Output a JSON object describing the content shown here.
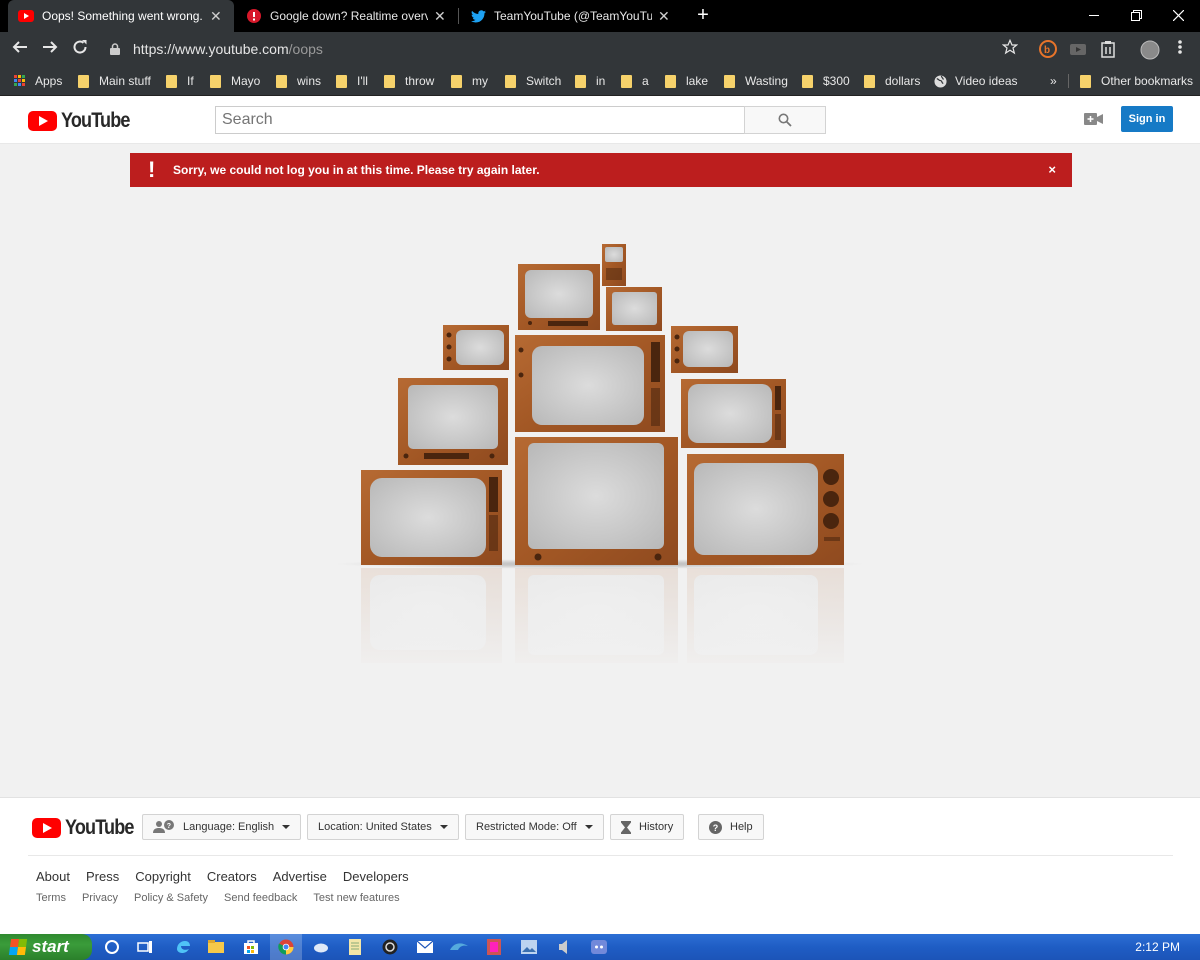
{
  "browser": {
    "tabs": [
      {
        "title": "Oops! Something went wrong. -",
        "icon": "youtube-icon",
        "active": true
      },
      {
        "title": "Google down? Realtime overview",
        "icon": "alert-icon",
        "active": false
      },
      {
        "title": "TeamYouTube (@TeamYouTube) |",
        "icon": "twitter-icon",
        "active": false
      }
    ],
    "new_tab": "+",
    "url_host": "https://www.youtube.com",
    "url_path": "/oops",
    "bookmarks": [
      "Apps",
      "Main stuff",
      "If",
      "Mayo",
      "wins",
      "I'll",
      "throw",
      "my",
      "Switch",
      "in",
      "a",
      "lake",
      "Wasting",
      "$300",
      "dollars",
      "Video ideas"
    ],
    "overflow": "»",
    "other_bookmarks": "Other bookmarks"
  },
  "header": {
    "logo_text": "YouTube",
    "search_placeholder": "Search",
    "signin_label": "Sign in"
  },
  "alert": {
    "icon": "!",
    "message": "Sorry, we could not log you in at this time. Please try again later.",
    "close": "×"
  },
  "footer": {
    "logo_text": "YouTube",
    "language": "Language: English",
    "location": "Location: United States",
    "restricted": "Restricted Mode: Off",
    "history": "History",
    "help": "Help",
    "links": [
      "About",
      "Press",
      "Copyright",
      "Creators",
      "Advertise",
      "Developers"
    ],
    "sublinks": [
      "Terms",
      "Privacy",
      "Policy & Safety",
      "Send feedback",
      "Test new features"
    ]
  },
  "taskbar": {
    "start_label": "start",
    "clock": "2:12 PM"
  },
  "colors": {
    "alert_red": "#bc1e1e",
    "signin_blue": "#167ac6",
    "yt_red": "#ff0000",
    "wood": "#a45a2a"
  }
}
